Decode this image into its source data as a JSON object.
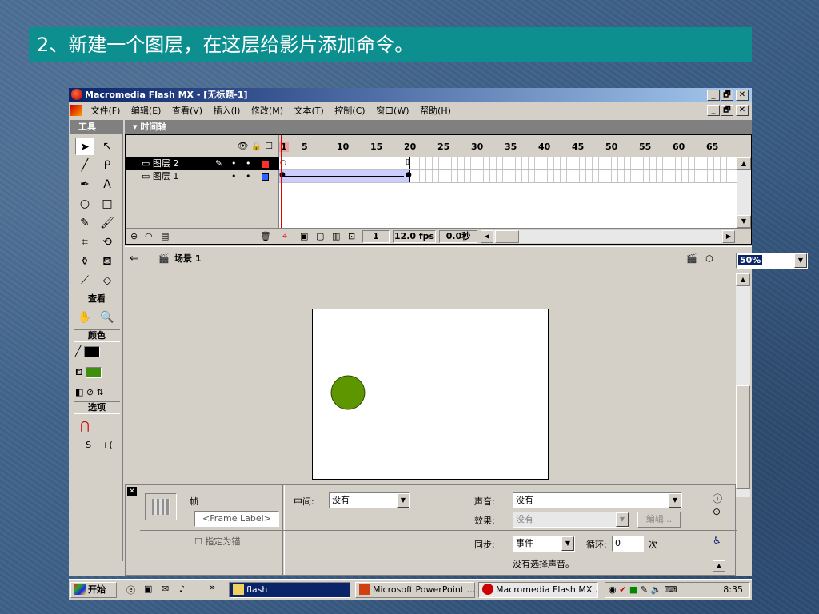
{
  "slide": {
    "title": "2、新建一个图层，在这层给影片添加命令。"
  },
  "window": {
    "title": "Macromedia Flash MX - [无标题-1]",
    "controls": {
      "minimize": "_",
      "maximize": "🗗",
      "close": "✕"
    }
  },
  "menu": {
    "items": [
      "文件(F)",
      "编辑(E)",
      "查看(V)",
      "插入(I)",
      "修改(M)",
      "文本(T)",
      "控制(C)",
      "窗口(W)",
      "帮助(H)"
    ]
  },
  "tools": {
    "header": "工具",
    "view_label": "查看",
    "colors_label": "颜色",
    "options_label": "选项",
    "stroke_color": "#000000",
    "fill_color": "#3f8f0f"
  },
  "timeline": {
    "header": "时间轴",
    "ruler_numbers": [
      "1",
      "5",
      "10",
      "15",
      "20",
      "25",
      "30",
      "35",
      "40",
      "45",
      "50",
      "55",
      "60",
      "65"
    ],
    "layers": [
      {
        "name": "图层 2",
        "color": "#ff3030",
        "selected": true
      },
      {
        "name": "图层 1",
        "color": "#3060ff",
        "selected": false
      }
    ],
    "current_frame": "1",
    "fps": "12.0 fps",
    "time": "0.0秒"
  },
  "scene": {
    "name": "场景 1",
    "zoom": "50%"
  },
  "stage": {
    "circle_color": "#5e9600"
  },
  "properties": {
    "type_label": "帧",
    "frame_label_placeholder": "<Frame Label>",
    "anchor_label": "指定为锚",
    "tween_label": "中间:",
    "tween_value": "没有",
    "sound_label": "声音:",
    "sound_value": "没有",
    "effect_label": "效果:",
    "effect_value": "没有",
    "edit_button": "编辑...",
    "sync_label": "同步:",
    "sync_value": "事件",
    "loop_label": "循环:",
    "loop_value": "0",
    "loop_unit": "次",
    "no_sound_text": "没有选择声音。"
  },
  "taskbar": {
    "start": "开始",
    "tasks": [
      "flash",
      "Microsoft PowerPoint ...",
      "Macromedia Flash MX ..."
    ],
    "clock": "8:35"
  }
}
